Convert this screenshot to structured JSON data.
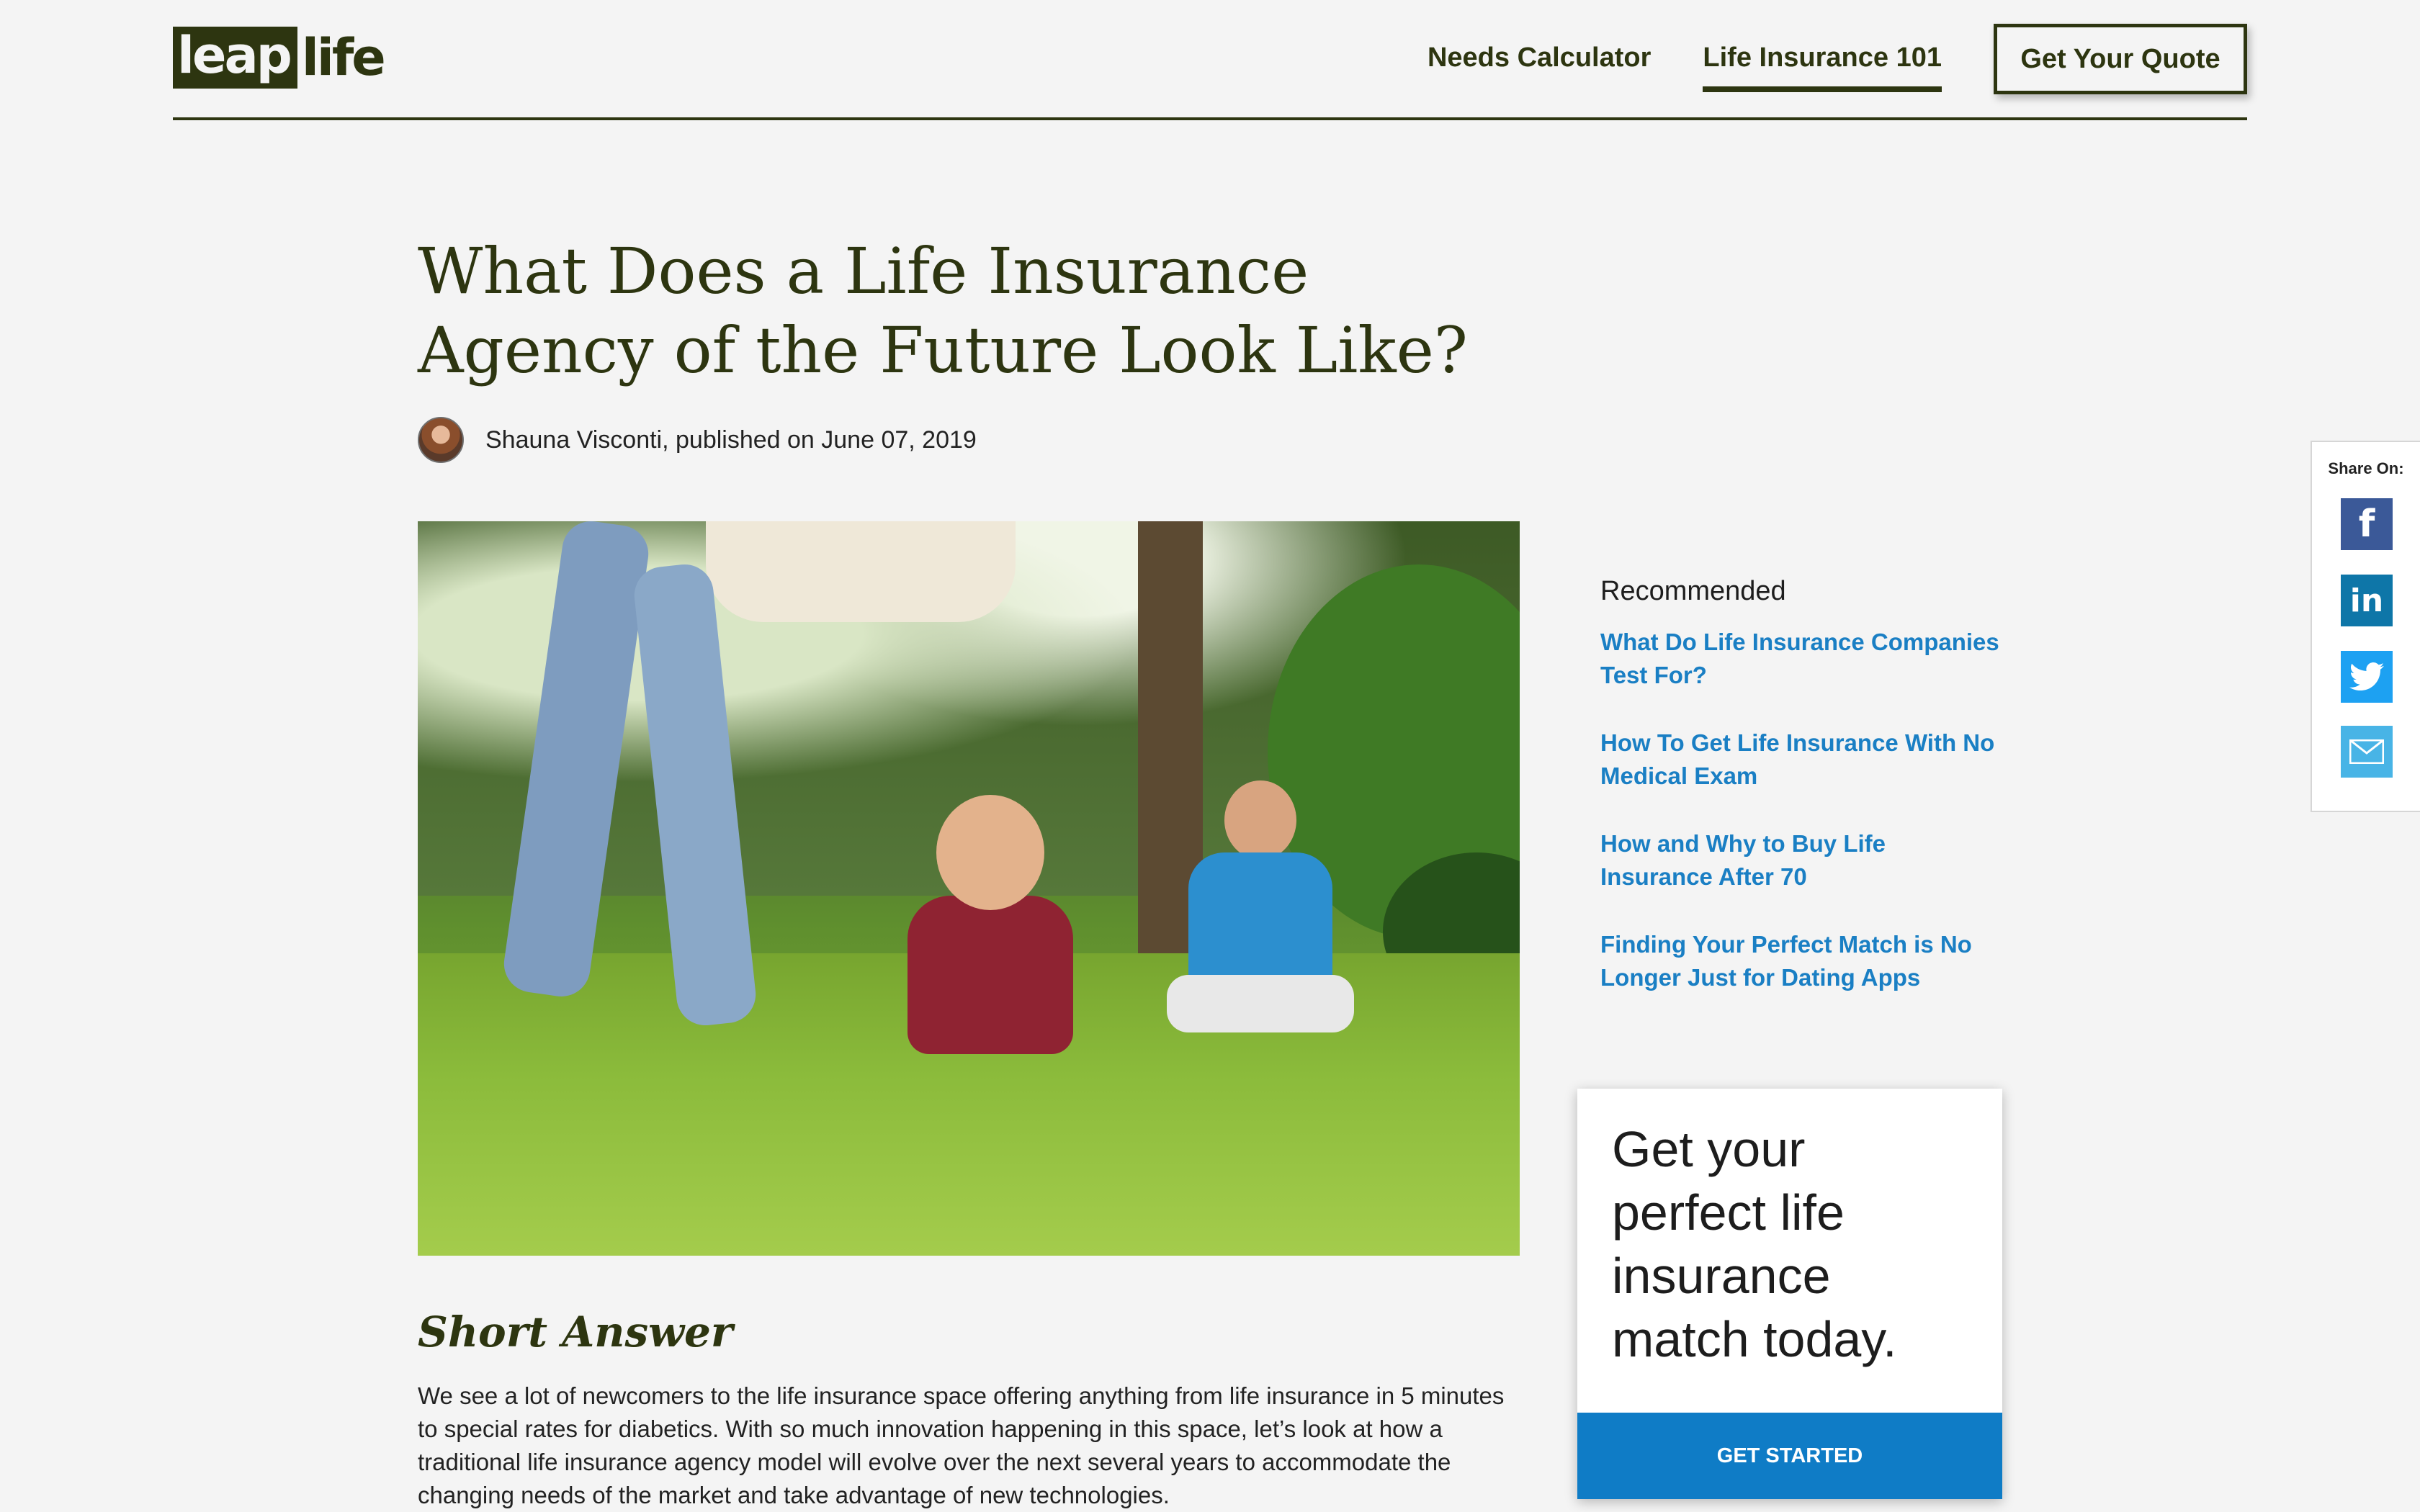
{
  "header": {
    "logo": {
      "part1": "leap",
      "part2": "life"
    },
    "nav": [
      {
        "label": "Needs Calculator",
        "active": false
      },
      {
        "label": "Life Insurance 101",
        "active": true
      }
    ],
    "cta_label": "Get Your Quote"
  },
  "article": {
    "title": "What Does a Life Insurance Agency of the Future Look Like?",
    "byline": "Shauna Visconti, published on June 07, 2019",
    "short_answer_heading": "Short Answer",
    "short_answer_body": "We see a lot of newcomers to the life insurance space offering anything from life insurance in 5 minutes to special rates for diabetics. With so much innovation happening in this space, let’s look at how a traditional life insurance agency model will evolve over the next several years to accommodate the changing needs of the market and take advantage of new technologies."
  },
  "sidebar": {
    "recommended_heading": "Recommended",
    "recommended": [
      "What Do Life Insurance Companies Test For?",
      "How To Get Life Insurance With No Medical Exam",
      "How and Why to Buy Life Insurance After 70",
      "Finding Your Perfect Match is No Longer Just for Dating Apps"
    ],
    "cta_card": {
      "text": "Get your perfect life insurance match today.",
      "button": "GET STARTED"
    }
  },
  "share": {
    "label": "Share On:",
    "buttons": [
      {
        "name": "facebook-icon",
        "glyph": "f"
      },
      {
        "name": "linkedin-icon",
        "glyph": "in"
      },
      {
        "name": "twitter-icon",
        "glyph": ""
      },
      {
        "name": "email-icon",
        "glyph": ""
      }
    ]
  },
  "colors": {
    "brand_dark": "#2d3510",
    "link_blue": "#1a7fc4",
    "button_blue": "#0f7cc6",
    "background": "#f4f4f4"
  }
}
